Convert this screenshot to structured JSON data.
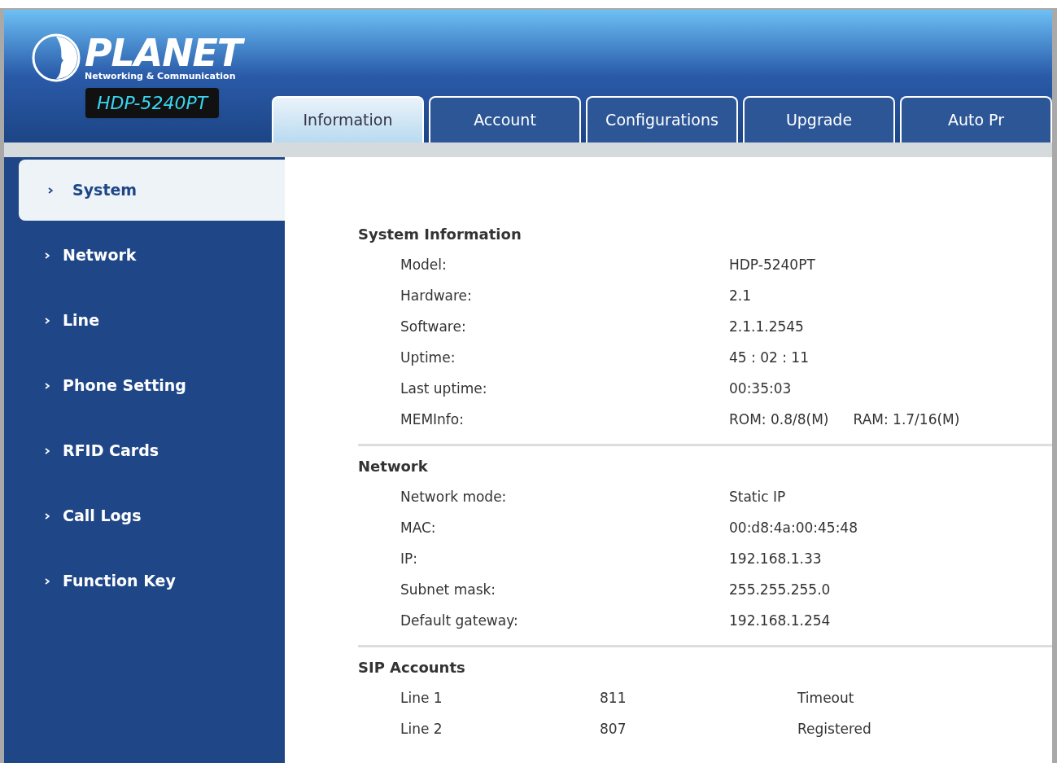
{
  "logo": {
    "brand": "PLANET",
    "tagline": "Networking & Communication",
    "model": "HDP-5240PT"
  },
  "tabs": [
    {
      "label": "Information",
      "selected": true
    },
    {
      "label": "Account",
      "selected": false
    },
    {
      "label": "Configurations",
      "selected": false
    },
    {
      "label": "Upgrade",
      "selected": false
    },
    {
      "label": "Auto Pr",
      "selected": false
    }
  ],
  "sidebar": {
    "items": [
      {
        "label": "System",
        "selected": true
      },
      {
        "label": "Network",
        "selected": false
      },
      {
        "label": "Line",
        "selected": false
      },
      {
        "label": "Phone Setting",
        "selected": false
      },
      {
        "label": "RFID Cards",
        "selected": false
      },
      {
        "label": "Call Logs",
        "selected": false
      },
      {
        "label": "Function Key",
        "selected": false
      }
    ]
  },
  "sections": [
    {
      "title": "System Information",
      "rows": [
        {
          "label": "Model:",
          "values": [
            "HDP-5240PT"
          ]
        },
        {
          "label": "Hardware:",
          "values": [
            "2.1"
          ]
        },
        {
          "label": "Software:",
          "values": [
            "2.1.1.2545"
          ]
        },
        {
          "label": "Uptime:",
          "values": [
            "45 : 02 : 11"
          ]
        },
        {
          "label": "Last uptime:",
          "values": [
            "00:35:03"
          ]
        },
        {
          "label": "MEMInfo:",
          "values": [
            "ROM: 0.8/8(M)",
            "RAM: 1.7/16(M)"
          ]
        }
      ]
    },
    {
      "title": "Network",
      "rows": [
        {
          "label": "Network mode:",
          "values": [
            "Static IP"
          ]
        },
        {
          "label": "MAC:",
          "values": [
            "00:d8:4a:00:45:48"
          ]
        },
        {
          "label": "IP:",
          "values": [
            "192.168.1.33"
          ]
        },
        {
          "label": "Subnet mask:",
          "values": [
            "255.255.255.0"
          ]
        },
        {
          "label": "Default gateway:",
          "values": [
            "192.168.1.254"
          ]
        }
      ]
    }
  ],
  "sip_accounts": {
    "title": "SIP Accounts",
    "rows": [
      {
        "line": "Line 1",
        "number": "811",
        "status": "Timeout"
      },
      {
        "line": "Line 2",
        "number": "807",
        "status": "Registered"
      }
    ]
  }
}
